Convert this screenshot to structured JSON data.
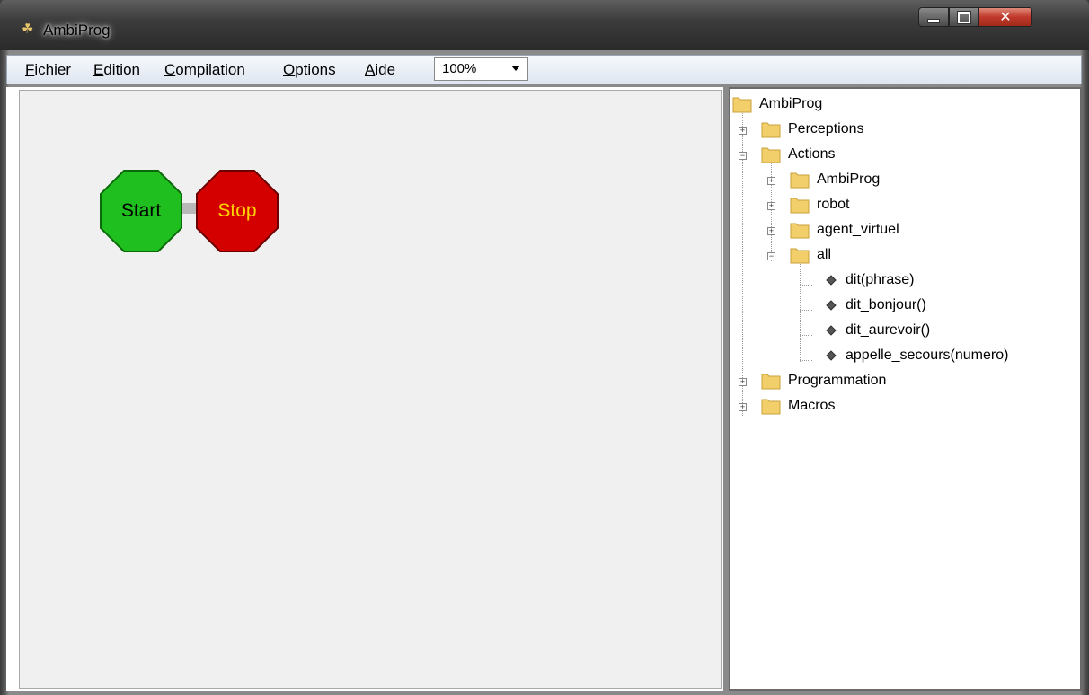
{
  "window": {
    "title": "AmbiProg"
  },
  "menu": {
    "items": [
      {
        "accel": "F",
        "rest": "ichier"
      },
      {
        "accel": "E",
        "rest": "dition"
      },
      {
        "accel": "C",
        "rest": "ompilation"
      },
      {
        "accel": "O",
        "rest": "ptions"
      },
      {
        "accel": "A",
        "rest": "ide"
      }
    ],
    "zoom": "100%"
  },
  "canvas": {
    "start_label": "Start",
    "stop_label": "Stop",
    "start_color": "#1fbf1f",
    "stop_color": "#d40000",
    "stop_text_color": "#ffd400"
  },
  "tree": {
    "root": "AmbiProg",
    "perceptions": "Perceptions",
    "actions": "Actions",
    "actions_children": [
      "AmbiProg",
      "robot",
      "agent_virtuel",
      "all"
    ],
    "all_children": [
      "dit(phrase)",
      "dit_bonjour()",
      "dit_aurevoir()",
      "appelle_secours(numero)"
    ],
    "programmation": "Programmation",
    "macros": "Macros"
  }
}
